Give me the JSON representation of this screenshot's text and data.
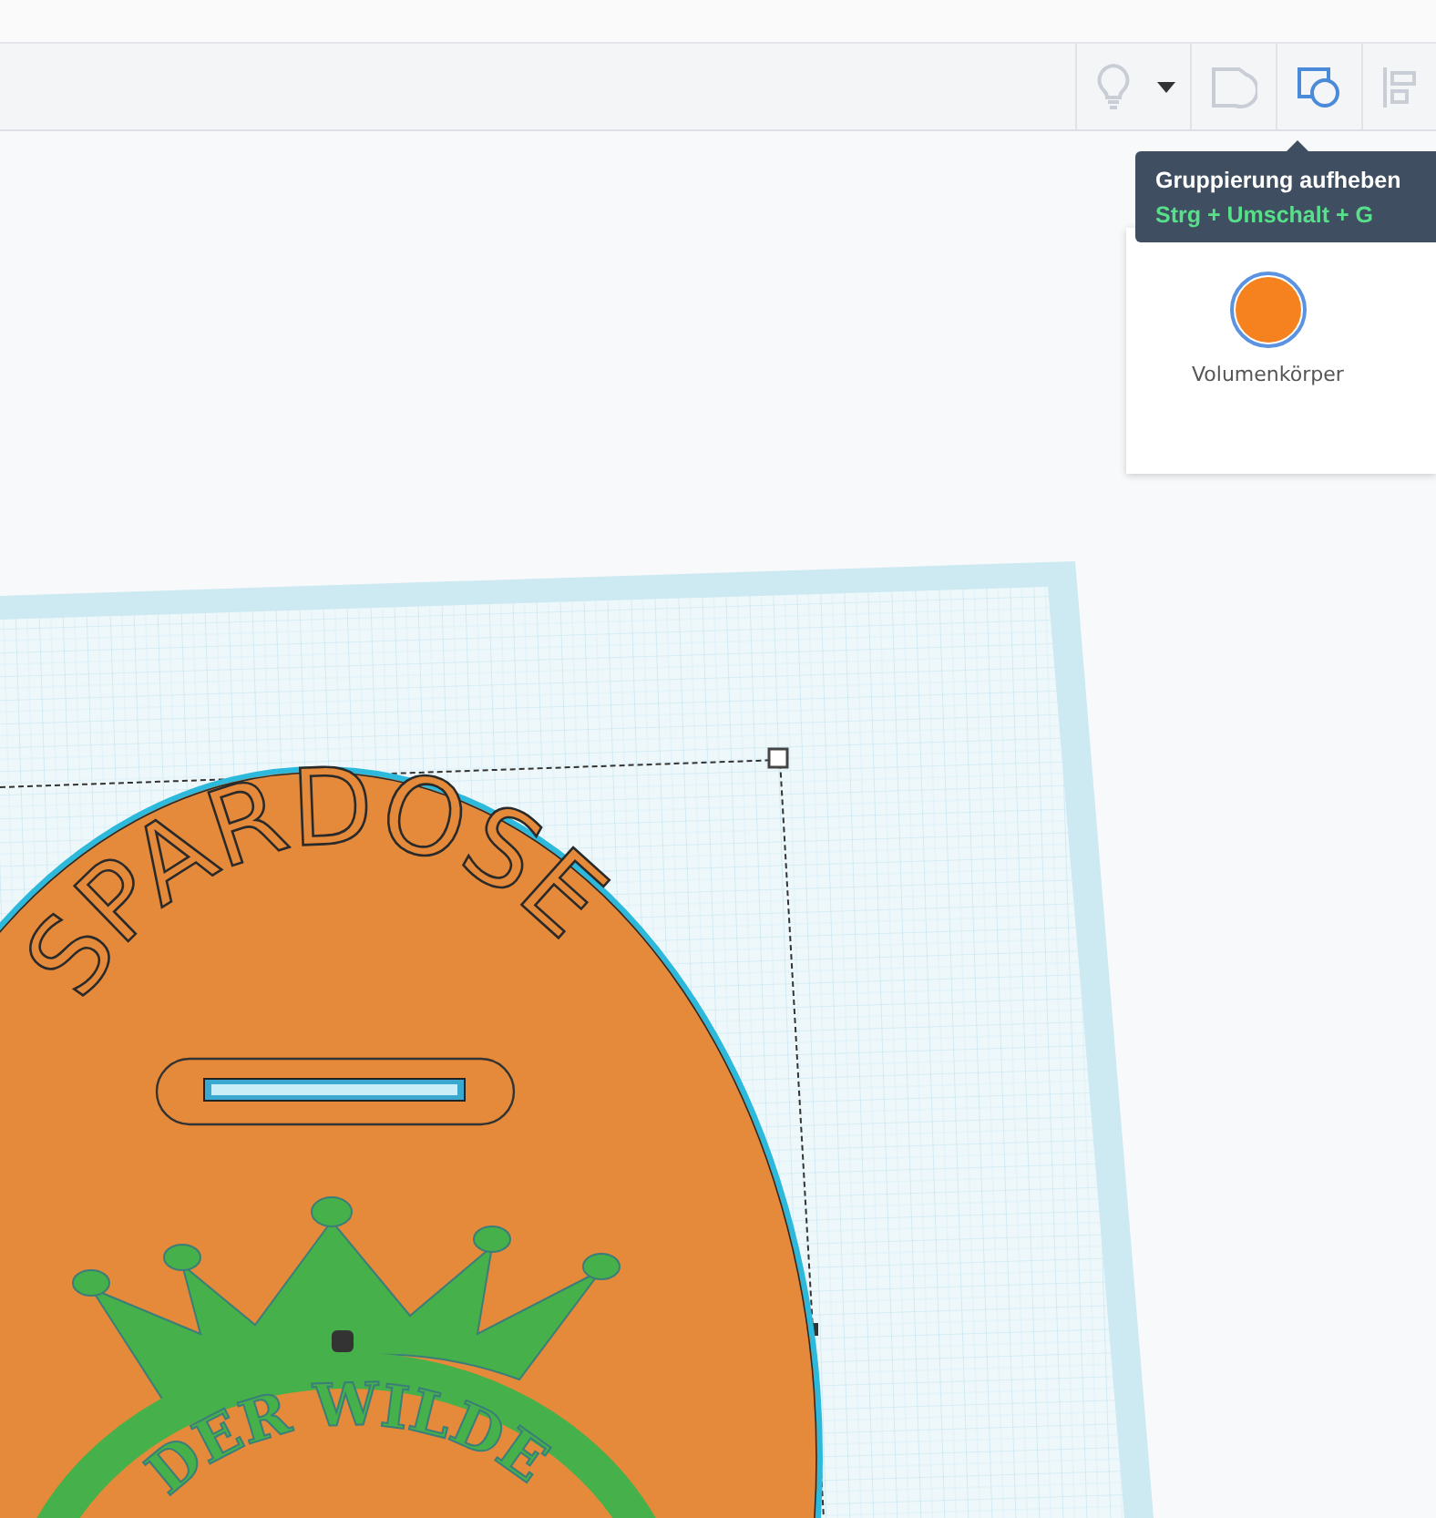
{
  "toolbar": {
    "buttons": [
      {
        "kind": "bulb",
        "disabled": true
      },
      {
        "kind": "dropdown",
        "disabled": false
      },
      {
        "kind": "group",
        "disabled": true
      },
      {
        "kind": "ungroup",
        "disabled": false
      },
      {
        "kind": "align",
        "disabled": true
      }
    ]
  },
  "tooltip": {
    "title": "Gruppierung aufheben",
    "shortcut": "Strg + Umschalt + G"
  },
  "shape_panel": {
    "options": [
      {
        "label": "Volumenkörper",
        "color": "#f5821f",
        "selected": true
      }
    ]
  },
  "model": {
    "title": "SPARDOSE",
    "subtitle": "DER WILDE"
  }
}
